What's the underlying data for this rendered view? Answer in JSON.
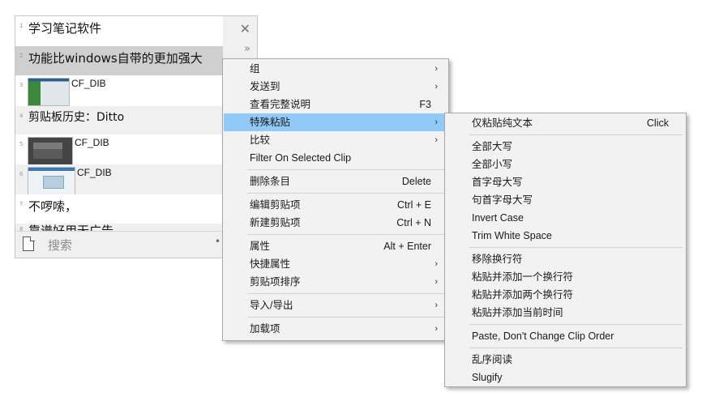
{
  "clip_list": {
    "rows": [
      {
        "num": "1",
        "text": "学习笔记软件"
      },
      {
        "num": "2",
        "text": "功能比windows自带的更加强大"
      },
      {
        "num": "3",
        "label": "CF_DIB"
      },
      {
        "num": "4",
        "text": "剪贴板历史：Ditto"
      },
      {
        "num": "5",
        "label": "CF_DIB"
      },
      {
        "num": "6",
        "label": "CF_DIB"
      },
      {
        "num": "7",
        "text": "不啰嗦，"
      },
      {
        "num": "8",
        "text": "靠谱好用无广告"
      }
    ],
    "close_glyph": "✕",
    "more_glyph": "»",
    "search_placeholder": "搜索",
    "search_dot": "•"
  },
  "context_menu": {
    "items": [
      {
        "label": "组",
        "arrow": "›"
      },
      {
        "label": "发送到",
        "arrow": "›"
      },
      {
        "label": "查看完整说明",
        "shortcut": "F3"
      },
      {
        "label": "特殊粘贴",
        "arrow": "›"
      },
      {
        "label": "比较",
        "arrow": "›"
      },
      {
        "label": "Filter On Selected Clip"
      },
      {
        "label": "删除条目",
        "shortcut": "Delete"
      },
      {
        "label": "编辑剪贴项",
        "shortcut": "Ctrl + E"
      },
      {
        "label": "新建剪贴项",
        "shortcut": "Ctrl + N"
      },
      {
        "label": "属性",
        "shortcut": "Alt + Enter"
      },
      {
        "label": "快捷属性",
        "arrow": "›"
      },
      {
        "label": "剪贴项排序",
        "arrow": "›"
      },
      {
        "label": "导入/导出",
        "arrow": "›"
      },
      {
        "label": "加载项",
        "arrow": "›"
      }
    ]
  },
  "special_paste_menu": {
    "items": [
      {
        "label": "仅粘贴纯文本",
        "shortcut": "Click"
      },
      {
        "label": "全部大写"
      },
      {
        "label": "全部小写"
      },
      {
        "label": "首字母大写"
      },
      {
        "label": "句首字母大写"
      },
      {
        "label": "Invert Case"
      },
      {
        "label": "Trim White Space"
      },
      {
        "label": "移除换行符"
      },
      {
        "label": "粘贴并添加一个换行符"
      },
      {
        "label": "粘贴并添加两个换行符"
      },
      {
        "label": "粘贴并添加当前时间"
      },
      {
        "label": "Paste, Don't Change Clip Order"
      },
      {
        "label": "乱序阅读"
      },
      {
        "label": "Slugify"
      }
    ]
  },
  "colors": {
    "highlight": "#91c9f7",
    "selected_row": "#cfcfcf"
  }
}
